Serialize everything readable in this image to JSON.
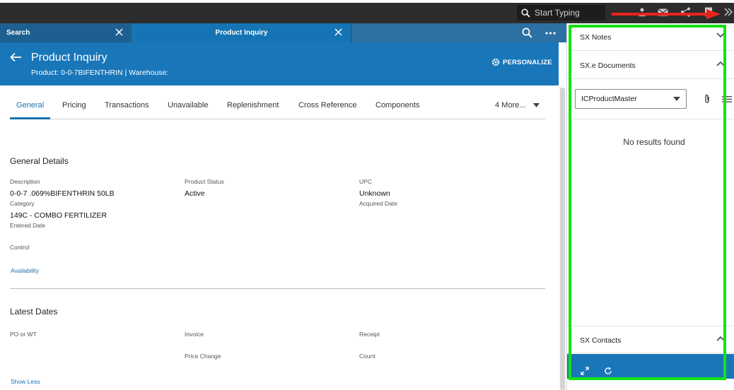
{
  "topbar": {
    "search_placeholder": "Start Typing"
  },
  "tabs": [
    {
      "label": "Search"
    },
    {
      "label": "Product Inquiry"
    }
  ],
  "header": {
    "title": "Product Inquiry",
    "subtitle": "Product: 0-0-7BIFENTHRIN | Warehouse:",
    "personalize_label": "PERSONALIZE"
  },
  "nav_tabs": [
    "General",
    "Pricing",
    "Transactions",
    "Unavailable",
    "Replenishment",
    "Cross Reference",
    "Components"
  ],
  "more_tabs": "4 More...",
  "general_details": {
    "title": "General Details",
    "description_label": "Description",
    "description_value": "0-0-7 .069%BIFENTHRIN 50LB",
    "category_label": "Category",
    "category_value": "149C - COMBO FERTILIZER",
    "entered_date_label": "Entered Date",
    "control_label": "Control",
    "product_status_label": "Product Status",
    "product_status_value": "Active",
    "upc_label": "UPC",
    "upc_value": "Unknown",
    "acquired_date_label": "Acquired Date",
    "availability_link": "Availability"
  },
  "latest_dates": {
    "title": "Latest Dates",
    "po_wt_label": "PO or WT",
    "invoice_label": "Invoice",
    "receipt_label": "Receipt",
    "price_change_label": "Price Change",
    "count_label": "Count",
    "show_less_link": "Show Less"
  },
  "right_panel": {
    "sx_notes": "SX Notes",
    "sxe_documents": "SX.e Documents",
    "document_select_value": "ICProductMaster",
    "no_results": "No results found",
    "sx_contacts": "SX Contacts"
  },
  "colors": {
    "brand_blue": "#1976b9",
    "highlight_green": "#12e312",
    "arrow_red": "#e8231d"
  }
}
